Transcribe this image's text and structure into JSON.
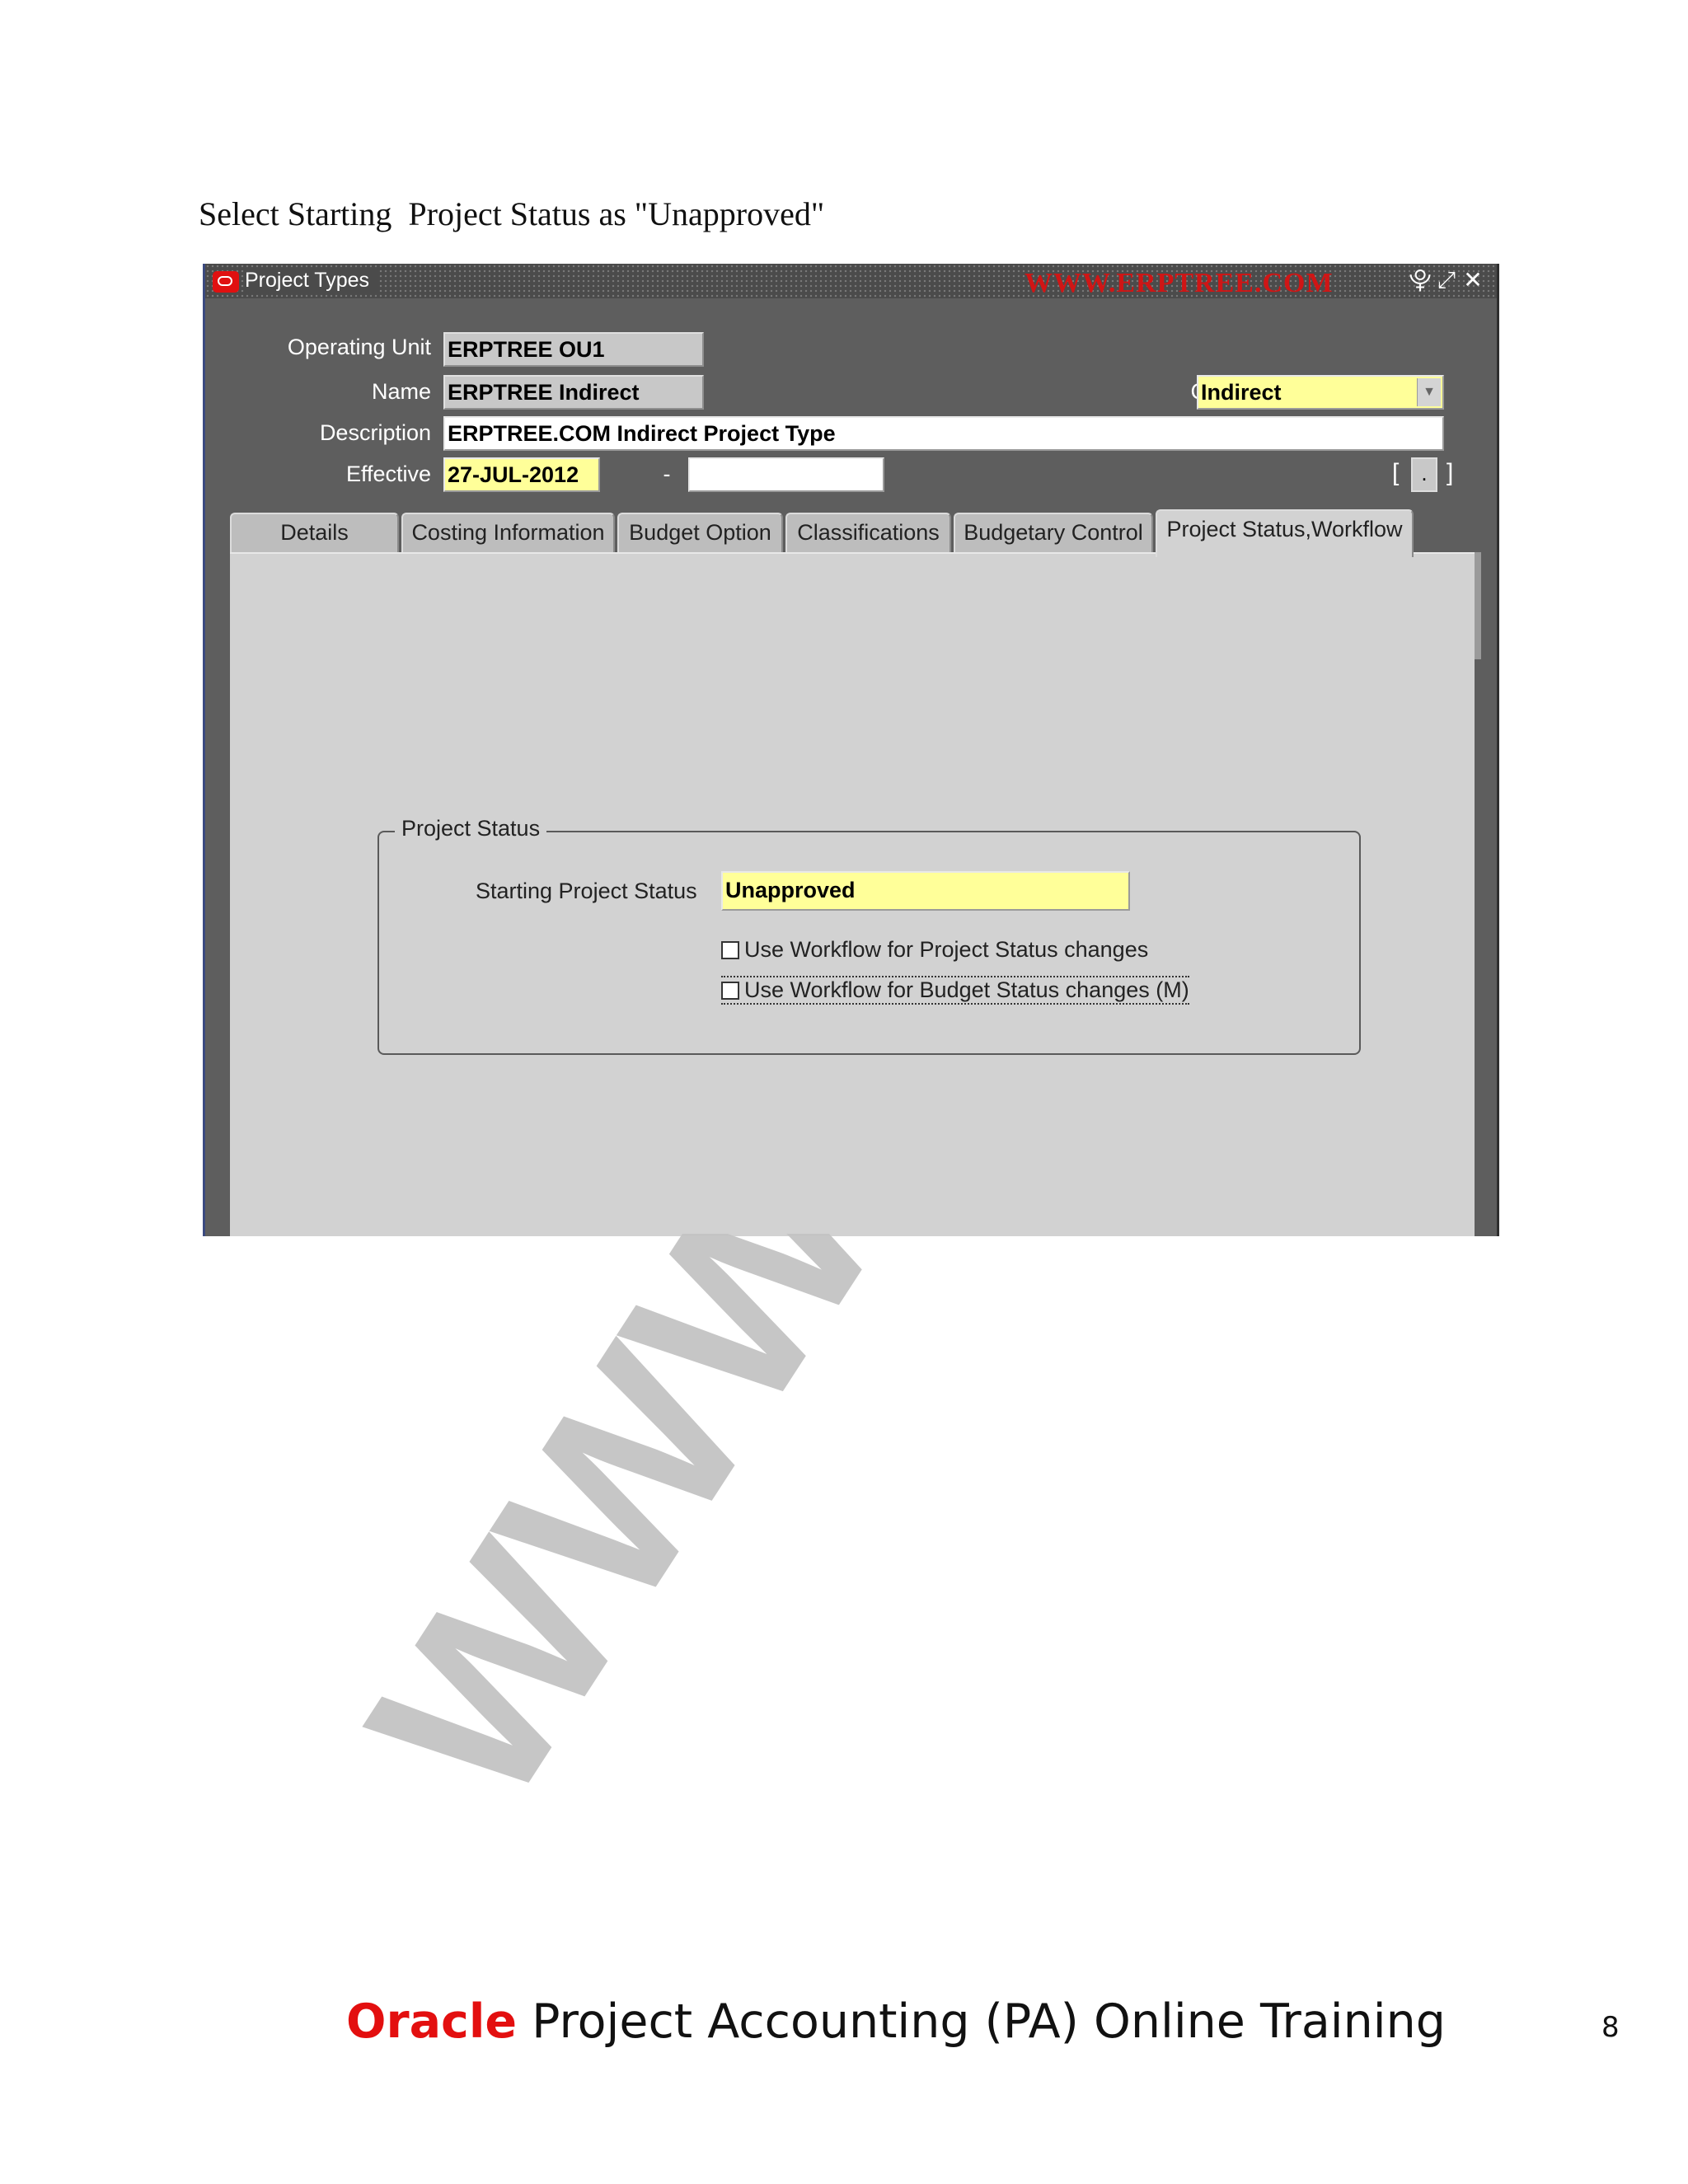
{
  "instruction": "Select Starting  Project Status as \"Unapproved\"",
  "window": {
    "title": "Project Types",
    "title_watermark": "WWW.ERPTREE.COM",
    "controls": [
      "⯓",
      "⤢",
      "✕"
    ]
  },
  "header": {
    "operating_unit_label": "Operating Unit",
    "operating_unit_value": "ERPTREE OU1",
    "name_label": "Name",
    "name_value": "ERPTREE Indirect",
    "class_label": "Class",
    "class_value": "Indirect",
    "description_label": "Description",
    "description_value": "ERPTREE.COM Indirect Project Type",
    "effective_label": "Effective",
    "effective_from": "27-JUL-2012",
    "effective_dash": "-",
    "effective_to": "",
    "dff_button": "."
  },
  "tabs": [
    {
      "label": "Details"
    },
    {
      "label": "Costing Information"
    },
    {
      "label": "Budget Option"
    },
    {
      "label": "Classifications"
    },
    {
      "label": "Budgetary Control"
    },
    {
      "label": "Project Status,Workflow",
      "active": true
    }
  ],
  "project_status": {
    "group_title": "Project Status",
    "starting_status_label": "Starting Project Status",
    "starting_status_value": "Unapproved",
    "workflow_project_label": "Use Workflow for Project Status changes",
    "workflow_project_checked": false,
    "workflow_budget_label": "Use Workflow for Budget Status changes (M)",
    "workflow_budget_checked": false
  },
  "watermark": "WWW.ERPTREE.COM",
  "footer": {
    "brand": "Oracle",
    "text": " Project Accounting (PA) Online Training",
    "page_number": "8"
  }
}
